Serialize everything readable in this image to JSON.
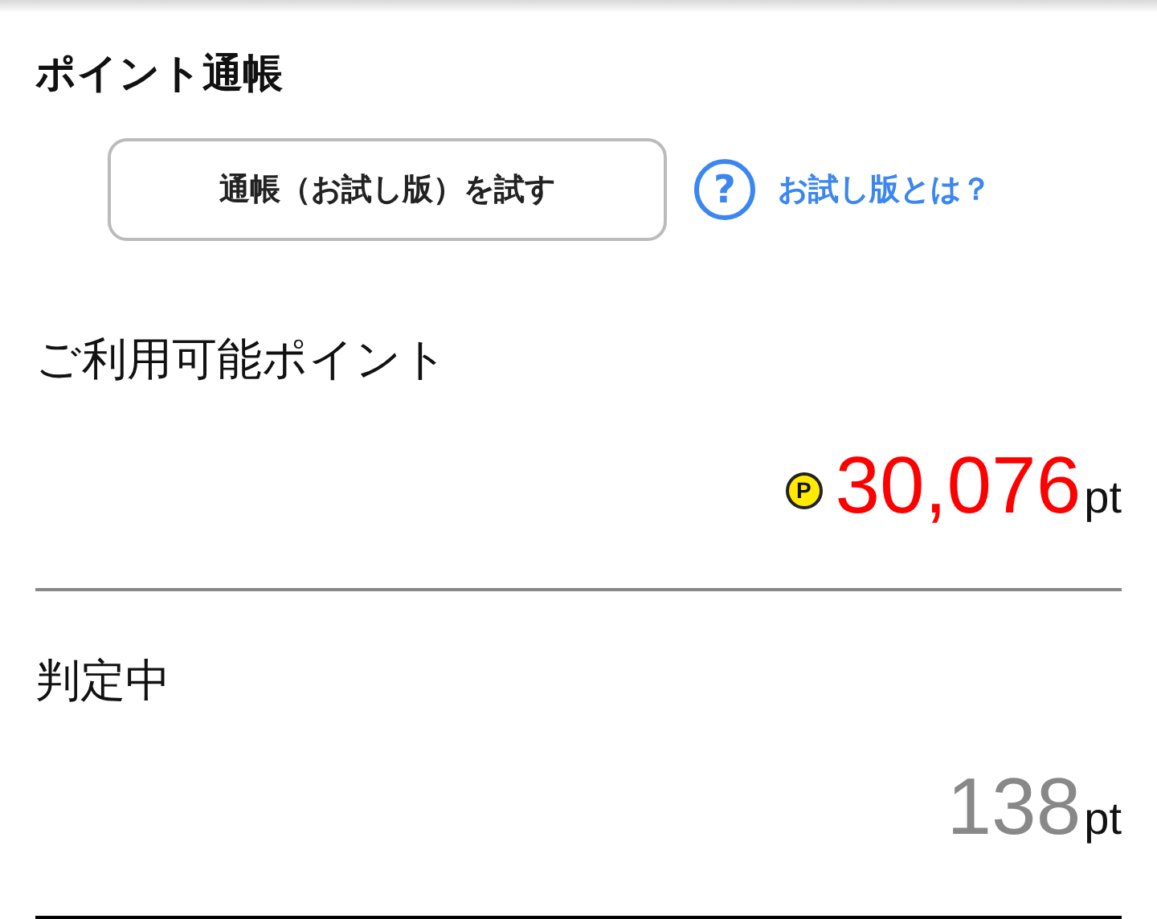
{
  "title": "ポイント通帳",
  "trial_button": {
    "label": "通帳（お試し版）を試す"
  },
  "help_link": {
    "icon_text": "?",
    "label": "お試し版とは？"
  },
  "balances": [
    {
      "kind": "available",
      "label": "ご利用可能ポイント",
      "coin_text": "P",
      "value": "30,076",
      "unit": "pt"
    },
    {
      "kind": "pending",
      "label": "判定中",
      "value": "138",
      "unit": "pt"
    }
  ]
}
